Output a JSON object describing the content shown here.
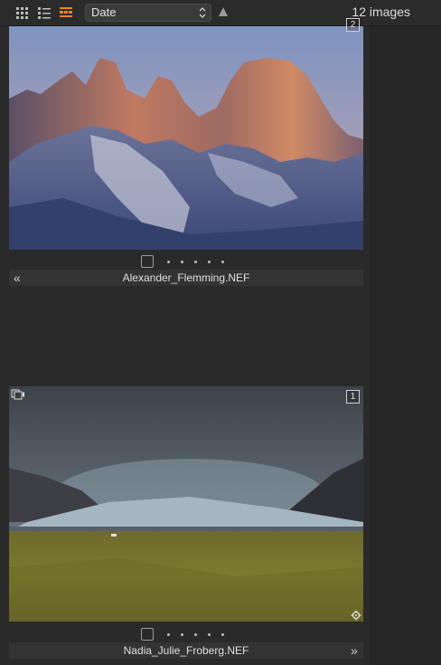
{
  "toolbar": {
    "grid_view_icon": "grid-icon",
    "list_view_icon": "list-icon",
    "filmstrip_view_icon": "filmstrip-icon",
    "sort_value": "Date",
    "sort_direction_icon": "triangle-up-icon",
    "image_count": "12 images",
    "active_color": "#e8832a"
  },
  "items": [
    {
      "filename": "Alexander_Flemming.NEF",
      "badge": "2",
      "rating_dots": 5,
      "nav_icon": "«"
    },
    {
      "filename": "Nadia_Julie_Froberg.NEF",
      "badge": "1",
      "rating_dots": 5,
      "nav_icon": "»"
    }
  ]
}
